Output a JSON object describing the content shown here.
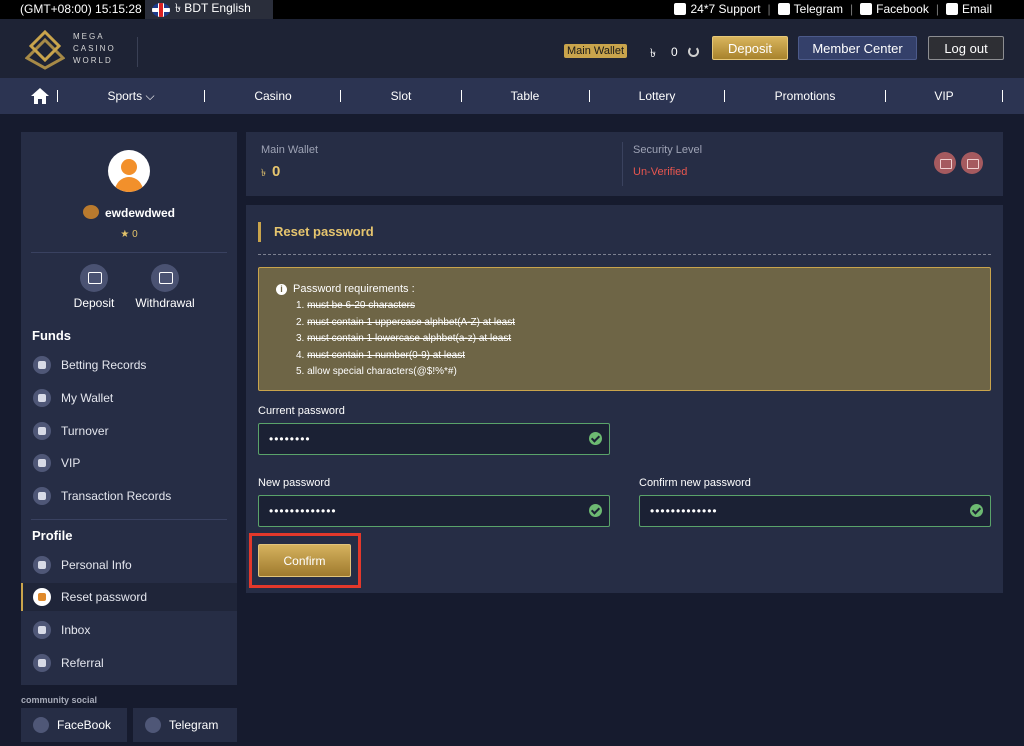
{
  "topbar": {
    "time": "(GMT+08:00) 15:15:28",
    "language": "৳ BDT English",
    "links": [
      {
        "label": "24*7 Support",
        "icon": "phone-icon"
      },
      {
        "label": "Telegram",
        "icon": "telegram-icon"
      },
      {
        "label": "Facebook",
        "icon": "facebook-icon"
      },
      {
        "label": "Email",
        "icon": "email-icon"
      }
    ]
  },
  "header": {
    "logo_line1": "MEGA",
    "logo_line2": "CASINO",
    "logo_line3": "WORLD",
    "wallet_tag": "Main Wallet",
    "currency": "৳",
    "balance": "0",
    "deposit_label": "Deposit",
    "member_label": "Member Center",
    "logout_label": "Log out"
  },
  "nav": {
    "items": [
      "Sports ⌵",
      "Casino",
      "Slot",
      "Table",
      "Lottery",
      "Promotions",
      "VIP"
    ]
  },
  "sidebar": {
    "username": "ewdewdwed",
    "stars": "★ 0",
    "quick": {
      "deposit": "Deposit",
      "withdrawal": "Withdrawal"
    },
    "funds_title": "Funds",
    "funds": [
      "Betting Records",
      "My Wallet",
      "Turnover",
      "VIP",
      "Transaction Records"
    ],
    "profile_title": "Profile",
    "profile": [
      "Personal Info",
      "Reset password",
      "Inbox",
      "Referral"
    ],
    "community_title": "community social",
    "social": [
      "FaceBook",
      "Telegram"
    ]
  },
  "wallet_panel": {
    "main_wallet_label": "Main Wallet",
    "currency": "৳",
    "balance": "0",
    "security_label": "Security Level",
    "security_status": "Un-Verified"
  },
  "reset": {
    "title": "Reset password",
    "req_head": "Password requirements :",
    "requirements": [
      "must be 6-20 characters",
      "must contain 1 uppercase alphbet(A-Z) at least",
      "must contain 1 lowercase alphbet(a-z) at least",
      "must contain 1 number(0-9) at least",
      "allow special characters(@$!%*#)"
    ],
    "current_label": "Current password",
    "current_value": "••••••••",
    "new_label": "New password",
    "new_value": "•••••••••••••",
    "confirm_label": "Confirm new password",
    "confirm_value": "•••••••••••••",
    "confirm_button": "Confirm"
  },
  "colors": {
    "accent": "#c9a44c",
    "danger": "#e8564f",
    "highlight": "#e3382b",
    "valid": "#5aa36a"
  }
}
